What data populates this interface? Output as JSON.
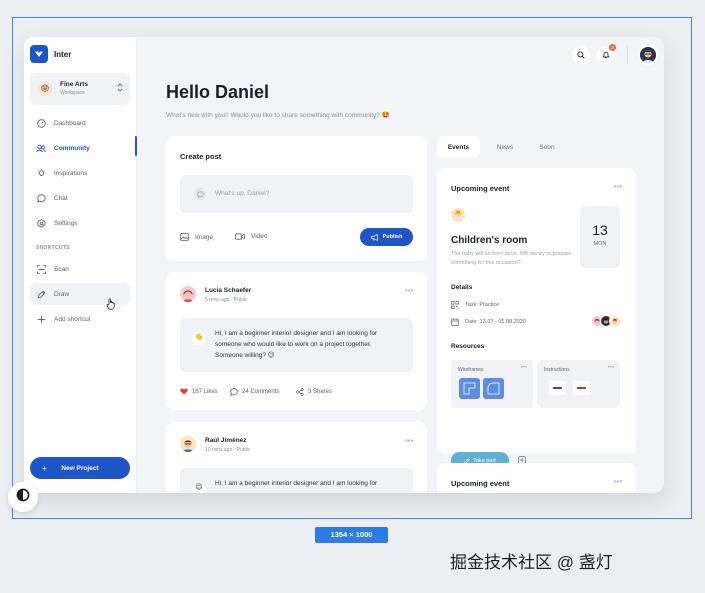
{
  "app": {
    "brand": "Inter",
    "workspace": {
      "name": "Fine Arts",
      "type": "Workspace",
      "emoji": "😝"
    }
  },
  "sidebar": {
    "items": [
      {
        "label": "Dashboard",
        "icon": "dashboard-icon"
      },
      {
        "label": "Community",
        "icon": "community-icon",
        "active": true
      },
      {
        "label": "Inspirations",
        "icon": "lightbulb-icon"
      },
      {
        "label": "Chat",
        "icon": "chat-icon"
      },
      {
        "label": "Settings",
        "icon": "gear-icon"
      }
    ],
    "shortcuts_label": "SHORTCUTS",
    "shortcuts": [
      {
        "label": "Scan",
        "icon": "scan-icon"
      },
      {
        "label": "Draw",
        "icon": "pen-icon"
      },
      {
        "label": "Add shortcut",
        "icon": "plus-icon"
      }
    ],
    "new_project": "New Project"
  },
  "topbar": {
    "notification_count": "3"
  },
  "header": {
    "greeting": "Hello Daniel",
    "subtitle": "What's new with you? Would you like to share something with community? 🤩"
  },
  "create_post": {
    "title": "Create post",
    "placeholder": "What's up, Daniel?",
    "image_label": "Image",
    "video_label": "Video",
    "publish_label": "Publish"
  },
  "posts": [
    {
      "author": "Lucia Schaefer",
      "time": "5 mins ago",
      "visibility": "Public",
      "emoji": "👋",
      "text_lines": [
        "Hi, I am a beginner interior designer and I am looking for",
        "someone who would like to work on a project together.",
        "Someone willing? 😉"
      ],
      "likes": "187 Likes",
      "comments": "24 Comments",
      "shares": "3 Shares"
    },
    {
      "author": "Raúl Jiménez",
      "time": "10 mins ago",
      "visibility": "Public",
      "emoji": "😉",
      "text_lines": [
        "Hi, I am a beginner interior designer and I am looking for"
      ]
    }
  ],
  "right_tabs": [
    "Events",
    "News",
    "Soon"
  ],
  "event": {
    "section_title": "Upcoming event",
    "emoji": "🐣",
    "name": "Children's room",
    "description": "The baby will be born soon. Will we try to prepare something for this occasion?",
    "day": "13",
    "month": "MON",
    "details_label": "Details",
    "task": "Task: Practice",
    "date": "Date: 13.07 - 01.08.2020",
    "resources_label": "Resources",
    "resources": [
      "Wireframes",
      "Instructions"
    ],
    "take_part": "Take part"
  },
  "event2": {
    "section_title": "Upcoming event"
  },
  "overlay": {
    "dimension_label": "1354 × 1000",
    "watermark": "掘金技术社区 @ 盏灯"
  },
  "colors": {
    "primary": "#1e56c8",
    "accent_teal": "#5fb0d6",
    "background": "#f3f4f7",
    "badge": "#ef6a3a"
  }
}
